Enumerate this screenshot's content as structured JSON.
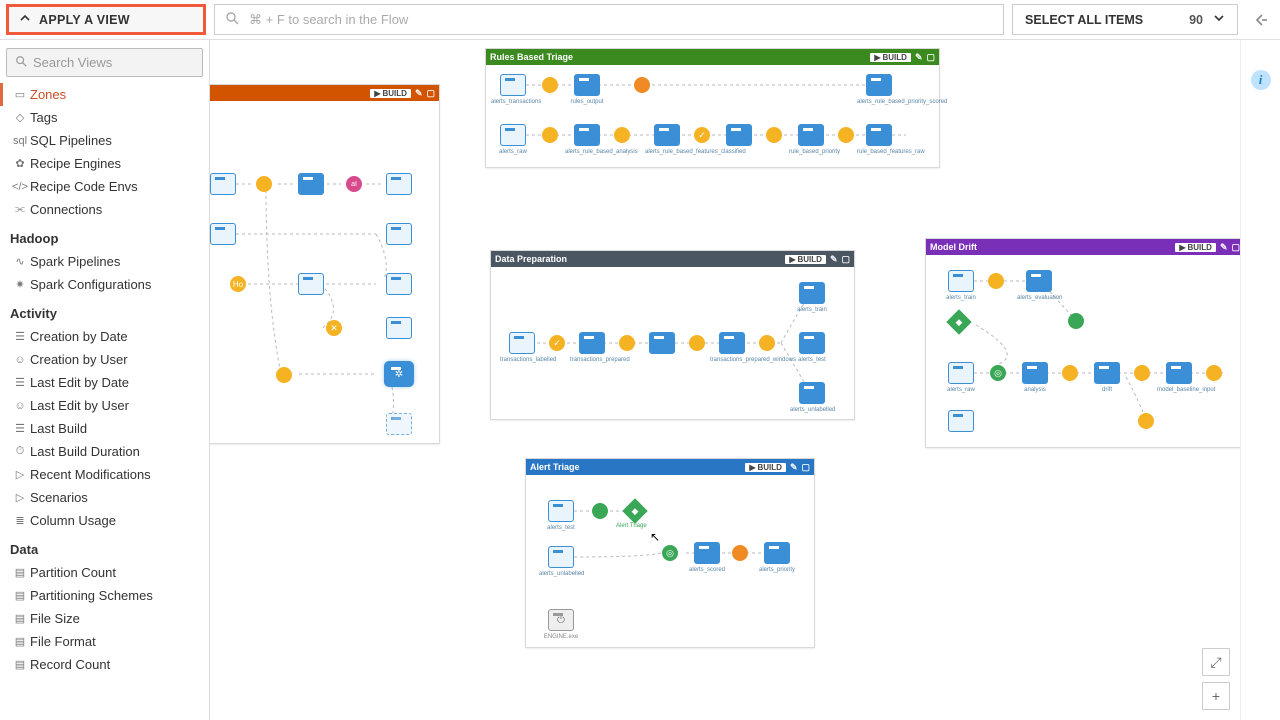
{
  "topbar": {
    "apply_view_label": "APPLY A VIEW",
    "search_placeholder": "⌘ + F to search in the Flow",
    "select_all_label": "SELECT ALL ITEMS",
    "select_all_count": "90"
  },
  "sidebar": {
    "search_placeholder": "Search Views",
    "items_top": [
      {
        "icon": "▭",
        "label": "Zones"
      },
      {
        "icon": "◇",
        "label": "Tags"
      },
      {
        "icon": "sql",
        "label": "SQL Pipelines"
      },
      {
        "icon": "✿",
        "label": "Recipe Engines"
      },
      {
        "icon": "</>",
        "label": "Recipe Code Envs"
      },
      {
        "icon": "⫘",
        "label": "Connections"
      }
    ],
    "group_hadoop": {
      "title": "Hadoop",
      "items": [
        {
          "icon": "∿",
          "label": "Spark Pipelines"
        },
        {
          "icon": "✷",
          "label": "Spark Configurations"
        }
      ]
    },
    "group_activity": {
      "title": "Activity",
      "items": [
        {
          "icon": "☰",
          "label": "Creation by Date"
        },
        {
          "icon": "☺",
          "label": "Creation by User"
        },
        {
          "icon": "☰",
          "label": "Last Edit by Date"
        },
        {
          "icon": "☺",
          "label": "Last Edit by User"
        },
        {
          "icon": "☰",
          "label": "Last Build"
        },
        {
          "icon": "⏱",
          "label": "Last Build Duration"
        },
        {
          "icon": "▷",
          "label": "Recent Modifications"
        },
        {
          "icon": "▷",
          "label": "Scenarios"
        },
        {
          "icon": "≣",
          "label": "Column Usage"
        }
      ]
    },
    "group_data": {
      "title": "Data",
      "items": [
        {
          "icon": "▤",
          "label": "Partition Count"
        },
        {
          "icon": "▤",
          "label": "Partitioning Schemes"
        },
        {
          "icon": "▤",
          "label": "File Size"
        },
        {
          "icon": "▤",
          "label": "File Format"
        },
        {
          "icon": "▤",
          "label": "Record Count"
        }
      ]
    }
  },
  "zones": {
    "orange": {
      "title": "",
      "build": "BUILD"
    },
    "green": {
      "title": "Rules Based Triage",
      "build": "BUILD",
      "row1_labels": [
        "alerts_transactions",
        "",
        "rules_output",
        "",
        "alerts_rule_based_priority_scored"
      ],
      "row2_labels": [
        "alerts_raw",
        "",
        "alerts_rule_based_analysis",
        "",
        "alerts_rule_based_features_classified",
        "",
        "",
        "rule_based_priority",
        "",
        "rule_based_features_raw"
      ]
    },
    "darkblue": {
      "title": "Data Preparation",
      "build": "BUILD",
      "labels": [
        "transactions_labelled",
        "transactions_prepared",
        "",
        "transactions_prepared_windows",
        "alerts_train",
        "alerts_test",
        "alerts_unlabelled"
      ]
    },
    "blue": {
      "title": "Alert Triage",
      "build": "BUILD",
      "labels": [
        "alerts_test",
        "alerts_unlabelled",
        "Alert Triage",
        "alerts_scored",
        "",
        "alerts_priority",
        "ENGINE.exe"
      ]
    },
    "purple": {
      "title": "Model Drift",
      "build": "BUILD",
      "labels": [
        "alerts_train",
        "alerts_evaluation",
        "",
        "alerts_raw",
        "",
        "analysis",
        "",
        "drift",
        "",
        "model_baseline_input",
        ""
      ]
    }
  },
  "right_rail": {
    "info": "i"
  },
  "zoom": {
    "fit": "⤢",
    "plus": "+"
  }
}
